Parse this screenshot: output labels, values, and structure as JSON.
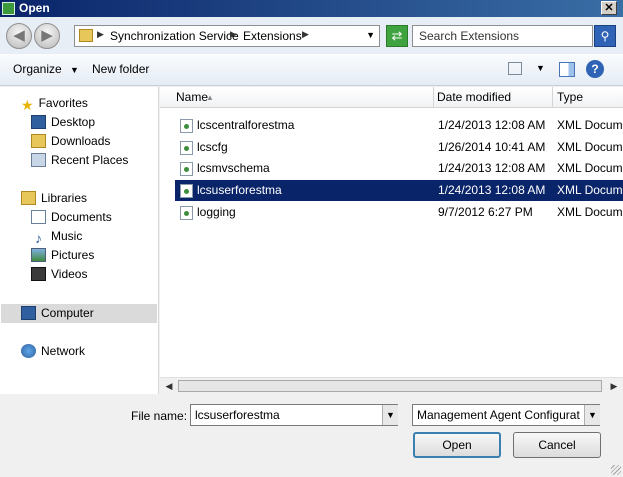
{
  "window": {
    "title": "Open"
  },
  "address_bar": {
    "crumbs": [
      "Synchronization Service",
      "Extensions"
    ]
  },
  "search": {
    "placeholder": "Search Extensions"
  },
  "toolbar": {
    "organize_label": "Organize",
    "new_folder_label": "New folder"
  },
  "nav_pane": {
    "favorites_header": "Favorites",
    "favorites": [
      "Desktop",
      "Downloads",
      "Recent Places"
    ],
    "libraries_header": "Libraries",
    "libraries": [
      "Documents",
      "Music",
      "Pictures",
      "Videos"
    ],
    "computer_label": "Computer",
    "network_label": "Network"
  },
  "file_list": {
    "columns": [
      "Name",
      "Date modified",
      "Type"
    ],
    "rows": [
      {
        "name": "lcscentralforestma",
        "date": "1/24/2013 12:08 AM",
        "type": "XML Docume"
      },
      {
        "name": "lcscfg",
        "date": "1/26/2014 10:41 AM",
        "type": "XML Docume"
      },
      {
        "name": "lcsmvschema",
        "date": "1/24/2013 12:08 AM",
        "type": "XML Docume"
      },
      {
        "name": "lcsuserforestma",
        "date": "1/24/2013 12:08 AM",
        "type": "XML Docume",
        "selected": true
      },
      {
        "name": "logging",
        "date": "9/7/2012 6:27 PM",
        "type": "XML Docume"
      }
    ]
  },
  "bottom": {
    "file_name_label": "File name:",
    "file_name_value": "lcsuserforestma",
    "file_type_value": "Management Agent Configurat",
    "open_label": "Open",
    "cancel_label": "Cancel"
  },
  "colors": {
    "selection": "#0a246a",
    "title_gradient_start": "#0a246a",
    "title_gradient_end": "#3a6ea5"
  }
}
